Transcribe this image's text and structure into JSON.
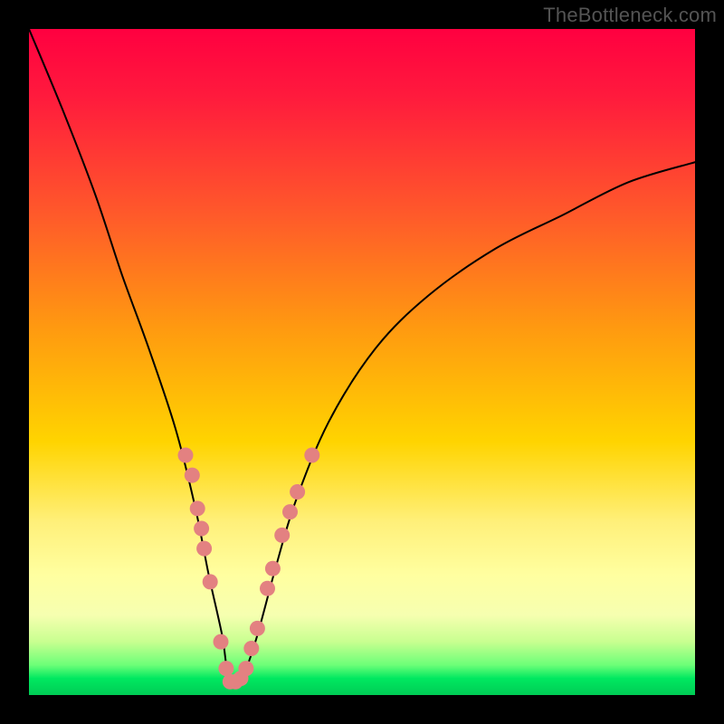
{
  "watermark": "TheBottleneck.com",
  "chart_data": {
    "type": "line",
    "title": "",
    "xlabel": "",
    "ylabel": "",
    "ylim": [
      0,
      100
    ],
    "xlim": [
      0,
      100
    ],
    "series": [
      {
        "name": "curve",
        "x": [
          0,
          5,
          10,
          14,
          18,
          22,
          25,
          27,
          29,
          30,
          32,
          34,
          37,
          40,
          45,
          52,
          60,
          70,
          80,
          90,
          100
        ],
        "y": [
          100,
          88,
          75,
          63,
          52,
          40,
          28,
          18,
          9,
          3,
          3,
          8,
          19,
          29,
          41,
          52,
          60,
          67,
          72,
          77,
          80
        ]
      }
    ],
    "markers": {
      "name": "highlighted-points",
      "color": "#e38181",
      "points": [
        {
          "x": 23.5,
          "y": 36
        },
        {
          "x": 24.5,
          "y": 33
        },
        {
          "x": 25.3,
          "y": 28
        },
        {
          "x": 25.9,
          "y": 25
        },
        {
          "x": 26.3,
          "y": 22
        },
        {
          "x": 27.2,
          "y": 17
        },
        {
          "x": 28.8,
          "y": 8
        },
        {
          "x": 29.6,
          "y": 4
        },
        {
          "x": 30.2,
          "y": 2
        },
        {
          "x": 31.0,
          "y": 2
        },
        {
          "x": 31.8,
          "y": 2.5
        },
        {
          "x": 32.6,
          "y": 4
        },
        {
          "x": 33.4,
          "y": 7
        },
        {
          "x": 34.3,
          "y": 10
        },
        {
          "x": 35.8,
          "y": 16
        },
        {
          "x": 36.6,
          "y": 19
        },
        {
          "x": 38.0,
          "y": 24
        },
        {
          "x": 39.2,
          "y": 27.5
        },
        {
          "x": 40.3,
          "y": 30.5
        },
        {
          "x": 42.5,
          "y": 36
        }
      ]
    },
    "gradient_bands": [
      {
        "y": 0,
        "color": "#ff0040"
      },
      {
        "y": 50,
        "color": "#ffcc00"
      },
      {
        "y": 92,
        "color": "#f0ffc0"
      },
      {
        "y": 100,
        "color": "#00cc55"
      }
    ]
  }
}
